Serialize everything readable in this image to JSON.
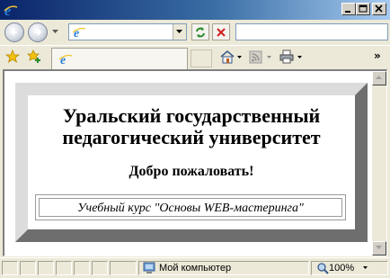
{
  "browser": {
    "address": {
      "value": ""
    },
    "search": {
      "value": ""
    },
    "tab": {
      "label": ""
    },
    "toolbar_overflow": "»"
  },
  "page": {
    "heading_line1": "Уральский государственный",
    "heading_line2": "педагогический университет",
    "welcome": "Добро пожаловать!",
    "course": "Учебный курс \"Основы WEB-мастеринга\""
  },
  "statusbar": {
    "zone": "Мой компьютер",
    "zoom": "100%"
  },
  "colors": {
    "titlebar_start": "#0a246a",
    "titlebar_end": "#a6caf0",
    "frame_light": "#dcdcdc",
    "frame_dark": "#6e6e6e",
    "frame_fill": "#a9a9a9"
  }
}
